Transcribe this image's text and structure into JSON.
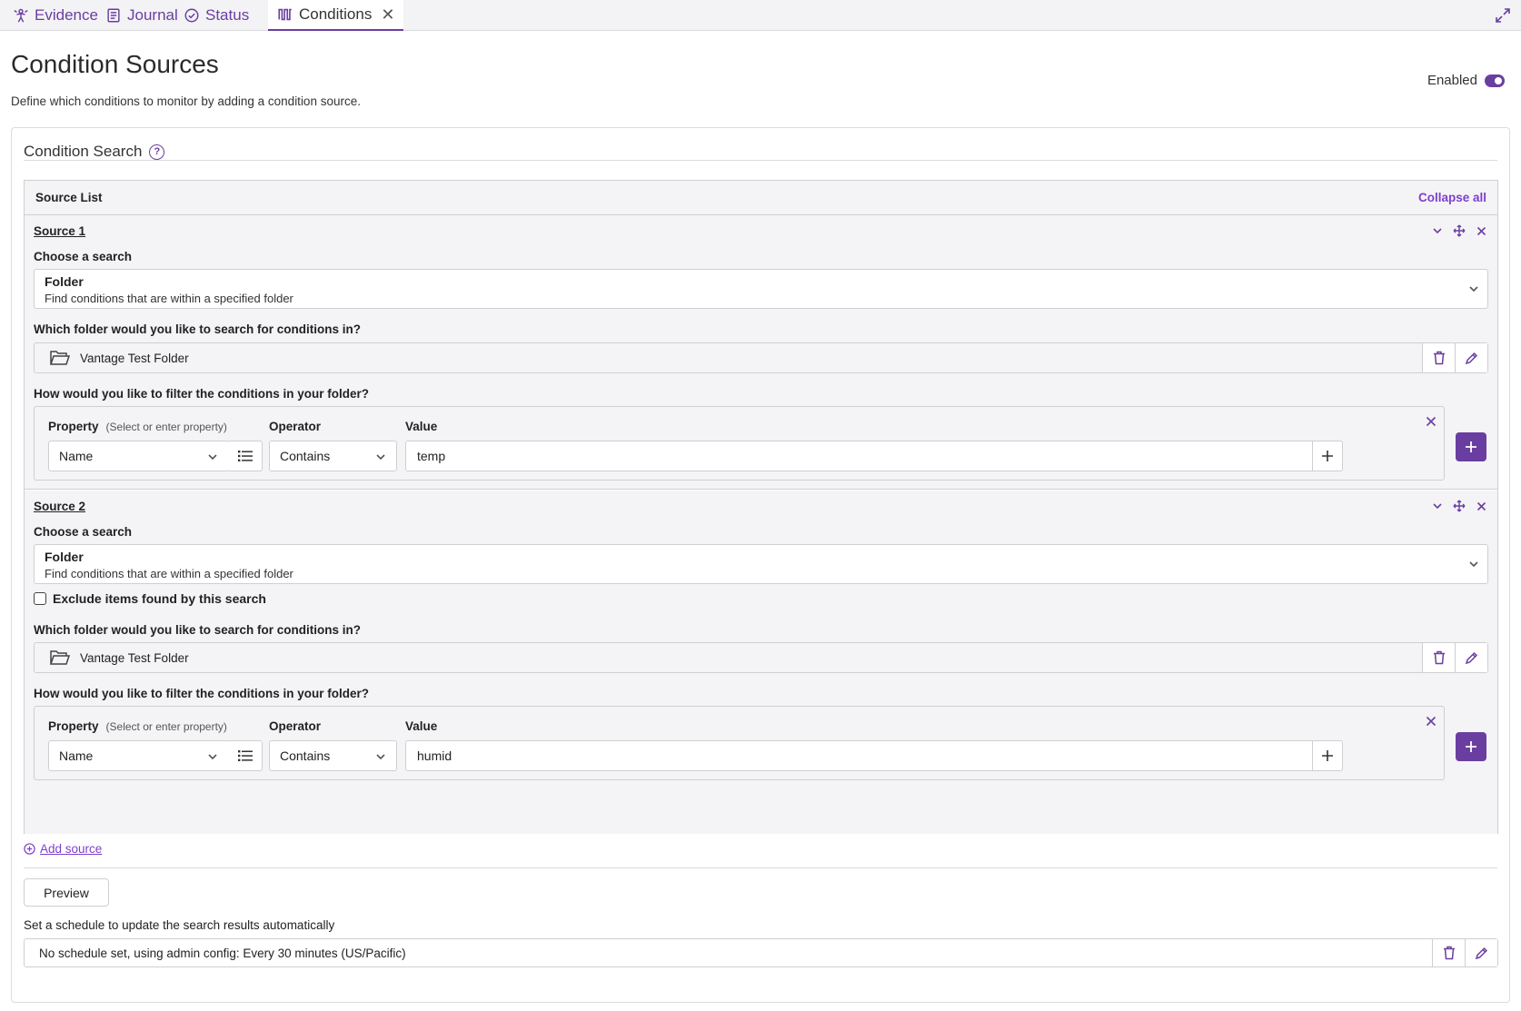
{
  "tabs": [
    {
      "label": "Evidence",
      "icon": "evidence-icon"
    },
    {
      "label": "Journal",
      "icon": "journal-icon"
    },
    {
      "label": "Status",
      "icon": "status-icon"
    },
    {
      "label": "Conditions",
      "icon": "conditions-icon",
      "active": true,
      "close": "✕"
    }
  ],
  "header": {
    "title": "Condition Sources",
    "subtitle": "Define which conditions to monitor by adding a condition source.",
    "enabled_label": "Enabled",
    "enabled": true
  },
  "card": {
    "title": "Condition Search",
    "help": "?",
    "source_list_title": "Source List",
    "collapse_all": "Collapse all"
  },
  "sources": [
    {
      "title": "Source 1",
      "choose_label": "Choose a search",
      "search_type": "Folder",
      "search_desc": "Find conditions that are within a specified folder",
      "folder_label": "Which folder would you like to search for conditions in?",
      "folder_name": "Vantage Test Folder",
      "filter_label": "How would you like to filter the conditions in your folder?",
      "property_label": "Property",
      "property_hint": "(Select or enter property)",
      "operator_label": "Operator",
      "value_label": "Value",
      "property": "Name",
      "operator": "Contains",
      "value": "temp"
    },
    {
      "title": "Source 2",
      "choose_label": "Choose a search",
      "search_type": "Folder",
      "search_desc": "Find conditions that are within a specified folder",
      "exclude_label": "Exclude items found by this search",
      "exclude_checked": false,
      "folder_label": "Which folder would you like to search for conditions in?",
      "folder_name": "Vantage Test Folder",
      "filter_label": "How would you like to filter the conditions in your folder?",
      "property_label": "Property",
      "property_hint": "(Select or enter property)",
      "operator_label": "Operator",
      "value_label": "Value",
      "property": "Name",
      "operator": "Contains",
      "value": "humid"
    }
  ],
  "add_source": "Add source",
  "preview": "Preview",
  "schedule": {
    "label": "Set a schedule to update the search results automatically",
    "value": "No schedule set, using admin config: Every 30 minutes (US/Pacific)"
  },
  "colors": {
    "accent": "#6a3ea1",
    "link": "#7d3fd0",
    "panel_bg": "#f4f4f6",
    "border": "#cfcfd3"
  }
}
